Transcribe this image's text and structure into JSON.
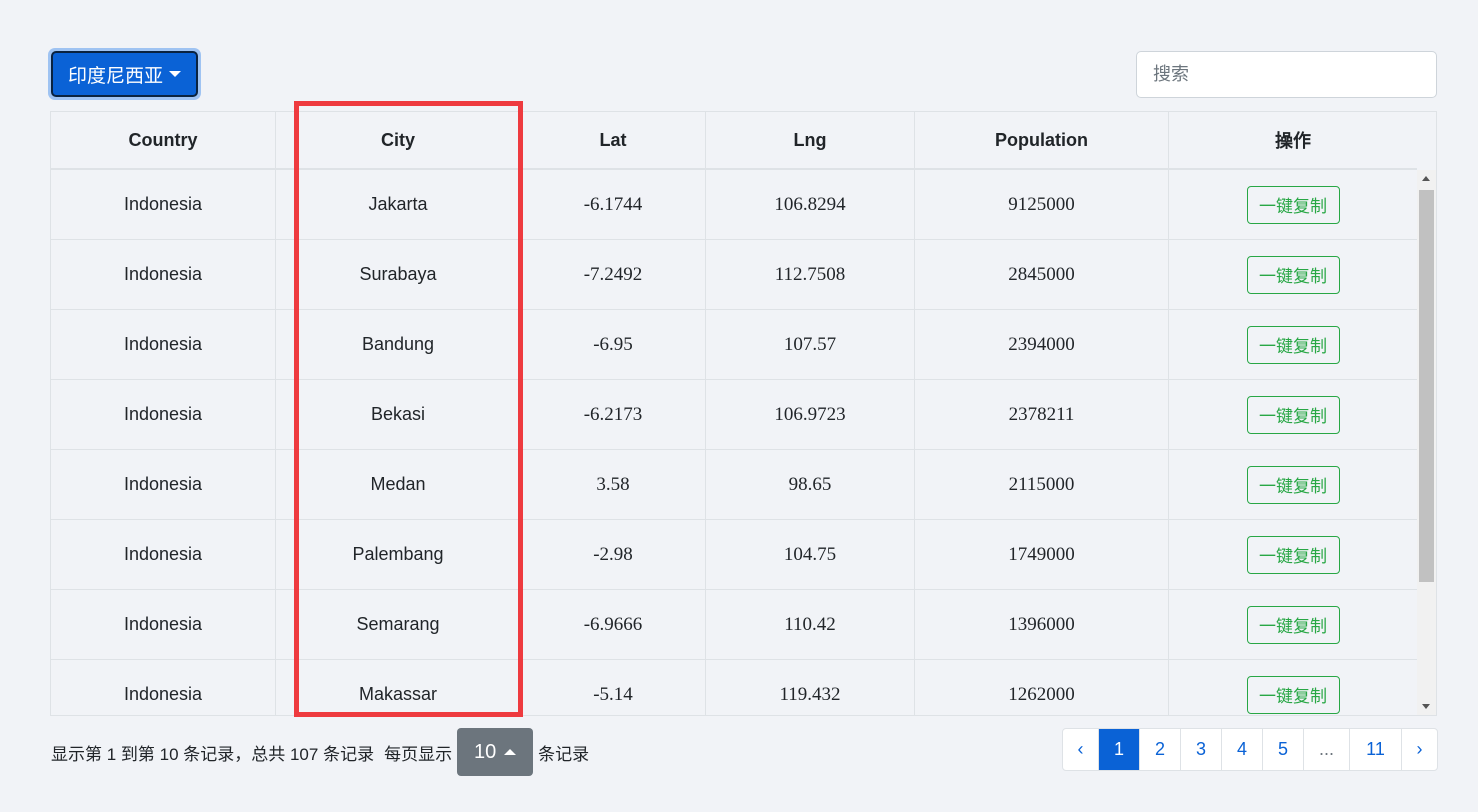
{
  "toolbar": {
    "country_dropdown_label": "印度尼西亚",
    "search_placeholder": "搜索"
  },
  "table": {
    "headers": [
      "Country",
      "City",
      "Lat",
      "Lng",
      "Population",
      "操作"
    ],
    "rows": [
      {
        "country": "Indonesia",
        "city": "Jakarta",
        "lat": "-6.1744",
        "lng": "106.8294",
        "population": "9125000",
        "action": "一键复制"
      },
      {
        "country": "Indonesia",
        "city": "Surabaya",
        "lat": "-7.2492",
        "lng": "112.7508",
        "population": "2845000",
        "action": "一键复制"
      },
      {
        "country": "Indonesia",
        "city": "Bandung",
        "lat": "-6.95",
        "lng": "107.57",
        "population": "2394000",
        "action": "一键复制"
      },
      {
        "country": "Indonesia",
        "city": "Bekasi",
        "lat": "-6.2173",
        "lng": "106.9723",
        "population": "2378211",
        "action": "一键复制"
      },
      {
        "country": "Indonesia",
        "city": "Medan",
        "lat": "3.58",
        "lng": "98.65",
        "population": "2115000",
        "action": "一键复制"
      },
      {
        "country": "Indonesia",
        "city": "Palembang",
        "lat": "-2.98",
        "lng": "104.75",
        "population": "1749000",
        "action": "一键复制"
      },
      {
        "country": "Indonesia",
        "city": "Semarang",
        "lat": "-6.9666",
        "lng": "110.42",
        "population": "1396000",
        "action": "一键复制"
      },
      {
        "country": "Indonesia",
        "city": "Makassar",
        "lat": "-5.14",
        "lng": "119.432",
        "population": "1262000",
        "action": "一键复制"
      }
    ]
  },
  "footer": {
    "info_text": "显示第 1 到第 10 条记录，总共 107 条记录",
    "per_page_prefix": "每页显示",
    "page_size": "10",
    "per_page_suffix": "条记录"
  },
  "pagination": {
    "prev": "‹",
    "pages": [
      "1",
      "2",
      "3",
      "4",
      "5",
      "...",
      "11"
    ],
    "active": "1",
    "next": "›"
  },
  "colors": {
    "primary": "#0a62d6",
    "success": "#28a745",
    "highlight": "#ee3a3f",
    "secondary": "#6c757d"
  }
}
